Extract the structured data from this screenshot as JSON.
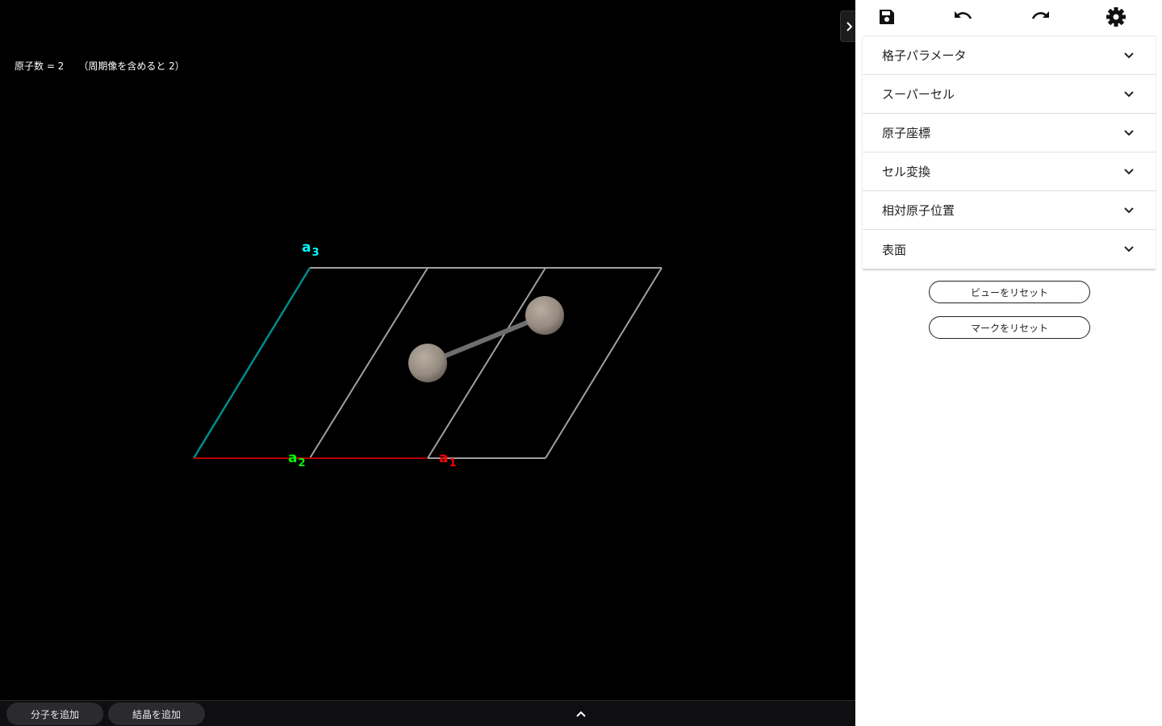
{
  "viewer": {
    "atom_count_text": "原子数 = 2　　（周期像を含めると 2）",
    "axes": {
      "a1": {
        "letter": "a",
        "sub": "1",
        "color": "#ff0000"
      },
      "a2": {
        "letter": "a",
        "sub": "2",
        "color": "#00ff00"
      },
      "a3": {
        "letter": "a",
        "sub": "3",
        "color": "#00ffff"
      }
    },
    "colors": {
      "background": "#000000",
      "cell_edge": "#a0a0a0",
      "axis_a1_line": "#b30000",
      "axis_a3_line": "#008b8b",
      "atom": "#9a8f84",
      "bond": "#6e6e6e"
    }
  },
  "bottom_bar": {
    "add_molecule_label": "分子を追加",
    "add_crystal_label": "結晶を追加",
    "expand_icon": "chevron-up-icon"
  },
  "toolbar": {
    "icons": [
      "save-icon",
      "undo-icon",
      "redo-icon",
      "settings-icon"
    ]
  },
  "panel": {
    "sections": [
      {
        "label": "格子パラメータ"
      },
      {
        "label": "スーパーセル"
      },
      {
        "label": "原子座標"
      },
      {
        "label": "セル変換"
      },
      {
        "label": "相対原子位置"
      },
      {
        "label": "表面"
      }
    ],
    "reset_view_label": "ビューをリセット",
    "reset_marks_label": "マークをリセット"
  }
}
